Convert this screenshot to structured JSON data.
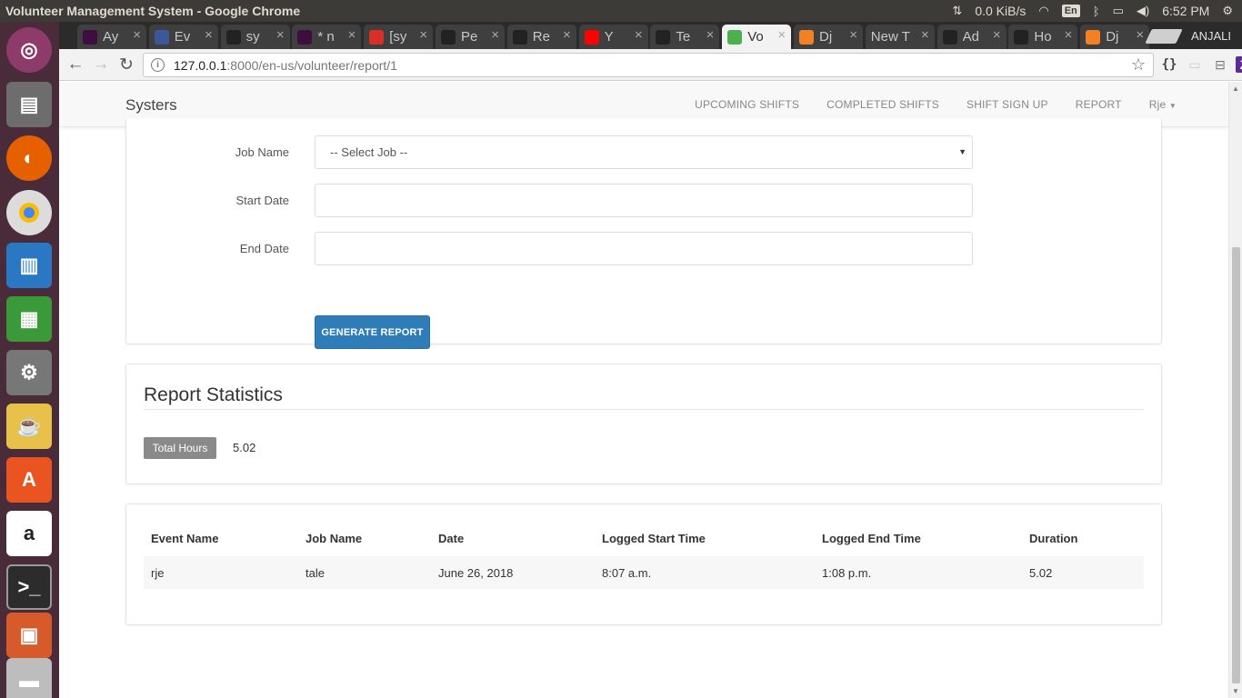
{
  "os": {
    "window_title": "Volunteer Management System - Google Chrome",
    "net_speed": "0.0 KiB/s",
    "lang": "En",
    "clock": "6:52 PM"
  },
  "browser": {
    "tabs": [
      {
        "label": "Ay",
        "icon": "slack-icon",
        "color": "#3f0e40"
      },
      {
        "label": "Ev",
        "icon": "facebook-icon",
        "color": "#3b5998"
      },
      {
        "label": "sy",
        "icon": "github-icon",
        "color": "#222222"
      },
      {
        "label": "* n",
        "icon": "slack-icon",
        "color": "#3f0e40"
      },
      {
        "label": "[sy",
        "icon": "gmail-icon",
        "color": "#d93025"
      },
      {
        "label": "Pe",
        "icon": "github-icon",
        "color": "#222222"
      },
      {
        "label": "Re",
        "icon": "github-error-icon",
        "color": "#222222"
      },
      {
        "label": "Y",
        "icon": "youtube-icon",
        "color": "#ff0000"
      },
      {
        "label": "Te",
        "icon": "github-error-icon",
        "color": "#222222"
      },
      {
        "label": "Vo",
        "icon": "vms-icon",
        "color": "#4caf50"
      },
      {
        "label": "Dj",
        "icon": "stackoverflow-icon",
        "color": "#f48024"
      },
      {
        "label": "New T",
        "icon": "",
        "color": ""
      },
      {
        "label": "Ad",
        "icon": "github-error-icon",
        "color": "#222222"
      },
      {
        "label": "Ho",
        "icon": "github-icon",
        "color": "#222222"
      },
      {
        "label": "Dj",
        "icon": "stackoverflow-icon",
        "color": "#f48024"
      }
    ],
    "active_tab_index": 9,
    "profile": "ANJALI",
    "url_host": "127.0.0.1",
    "url_path": ":8000/en-us/volunteer/report/1"
  },
  "site": {
    "brand": "Systers",
    "nav": {
      "upcoming": "UPCOMING SHIFTS",
      "completed": "COMPLETED SHIFTS",
      "signup": "SHIFT SIGN UP",
      "report": "REPORT",
      "user": "Rje"
    }
  },
  "form": {
    "job_label": "Job Name",
    "job_value": "-- Select Job --",
    "start_label": "Start Date",
    "start_value": "",
    "end_label": "End Date",
    "end_value": "",
    "submit": "GENERATE REPORT"
  },
  "stats": {
    "title": "Report Statistics",
    "total_label": "Total Hours",
    "total_value": "5.02"
  },
  "table": {
    "headers": [
      "Event Name",
      "Job Name",
      "Date",
      "Logged Start Time",
      "Logged End Time",
      "Duration"
    ],
    "rows": [
      [
        "rje",
        "tale",
        "June 26, 2018",
        "8:07 a.m.",
        "1:08 p.m.",
        "5.02"
      ]
    ]
  }
}
